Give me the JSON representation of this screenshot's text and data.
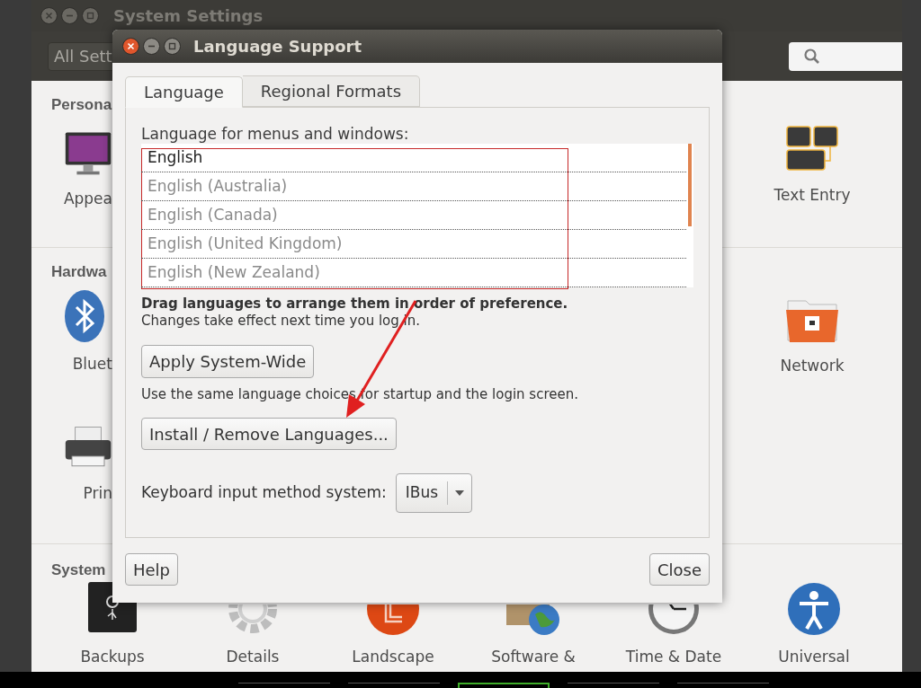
{
  "background_window": {
    "title": "System Settings",
    "back_button": "All Sett"
  },
  "sections": [
    {
      "title": "Persona",
      "left_items": [
        {
          "label": "Appea"
        }
      ],
      "right_items": [
        {
          "label": "Text Entry"
        }
      ]
    },
    {
      "title": "Hardwa",
      "left_items": [
        {
          "label": "Bluet"
        },
        {
          "label": "Prin"
        }
      ],
      "right_items": [
        {
          "label": "Network"
        }
      ]
    },
    {
      "title": "System",
      "items": [
        {
          "label": "Backups"
        },
        {
          "label": "Details"
        },
        {
          "label": "Landscape"
        },
        {
          "label": "Software &"
        },
        {
          "label": "Time & Date"
        },
        {
          "label": "Universal"
        }
      ]
    }
  ],
  "dialog": {
    "title": "Language Support",
    "tabs": [
      {
        "label": "Language",
        "selected": true
      },
      {
        "label": "Regional Formats",
        "selected": false
      }
    ],
    "list_label": "Language for menus and windows:",
    "languages": [
      {
        "name": "English",
        "active": true
      },
      {
        "name": "English (Australia)",
        "active": false
      },
      {
        "name": "English (Canada)",
        "active": false
      },
      {
        "name": "English (United Kingdom)",
        "active": false
      },
      {
        "name": "English (New Zealand)",
        "active": false
      }
    ],
    "hint_bold": "Drag languages to arrange them in order of preference.",
    "hint": "Changes take effect next time you log in.",
    "apply_button": "Apply System-Wide",
    "apply_note": "Use the same language choices for startup and the login screen.",
    "install_button": "Install / Remove Languages...",
    "input_method": {
      "label": "Keyboard input method system:",
      "value": "IBus"
    },
    "help_button": "Help",
    "close_button": "Close"
  },
  "taskbar": [
    {
      "selected": false
    },
    {
      "selected": false
    },
    {
      "selected": true
    },
    {
      "selected": false
    },
    {
      "selected": false
    }
  ]
}
